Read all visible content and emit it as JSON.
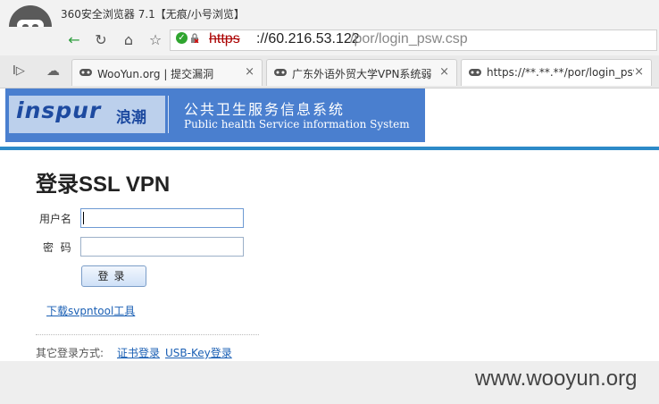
{
  "browser": {
    "title": "360安全浏览器 7.1【无痕/小号浏览】",
    "url": {
      "scheme": "https",
      "host": "://60.216.53.122",
      "path": "/por/login_psw.csp"
    }
  },
  "tabs": [
    {
      "label": "WooYun.org | 提交漏洞",
      "close": "×"
    },
    {
      "label": "广东外语外贸大学VPN系统弱",
      "close": "×"
    },
    {
      "label": "https://**.**.**/por/login_psw",
      "close": "×"
    }
  ],
  "banner": {
    "brand": "inspur",
    "brand_cn": "浪潮",
    "title_cn": "公共卫生服务信息系统",
    "title_en": "Public health Service information System"
  },
  "login": {
    "heading": "登录SSL VPN",
    "username_label": "用户名",
    "username_value": "",
    "password_label": "密  码",
    "password_value": "",
    "submit_label": "登录",
    "download_link": "下载svpntool工具",
    "other_methods_label": "其它登录方式:",
    "cert_login": "证书登录",
    "usbkey_login": "USB-Key登录"
  },
  "watermark": "www.wooyun.org",
  "colors": {
    "banner_bg": "#4a7fcf",
    "accent_rule": "#2d8ac8",
    "link": "#1a5fb4"
  }
}
